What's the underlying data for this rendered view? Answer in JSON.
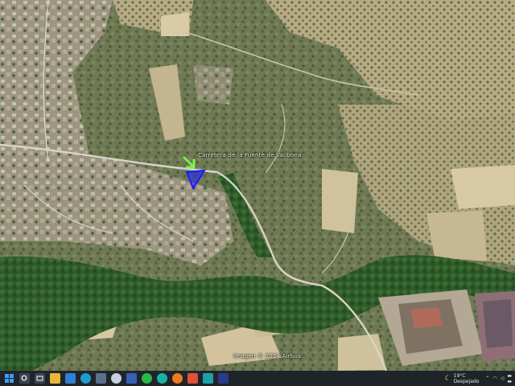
{
  "map": {
    "road_label": "Carretera de la Fuente de Vallbona",
    "copyright": "Imagen © 2024 Airbus",
    "marker_color": "#1a1aff",
    "pin_color": "#7cf04a"
  },
  "taskbar": {
    "apps": [
      {
        "name": "start-icon"
      },
      {
        "name": "search-icon"
      },
      {
        "name": "task-view-icon"
      },
      {
        "name": "file-explorer-icon"
      },
      {
        "name": "photos-icon"
      },
      {
        "name": "edge-icon"
      },
      {
        "name": "store-icon"
      },
      {
        "name": "media-icon"
      },
      {
        "name": "save-icon"
      },
      {
        "name": "whatsapp-icon"
      },
      {
        "name": "edge-dev-icon"
      },
      {
        "name": "firefox-icon"
      },
      {
        "name": "powerpoint-icon"
      },
      {
        "name": "sway-icon"
      },
      {
        "name": "paint-icon"
      }
    ],
    "weather": {
      "temp": "19°C",
      "condition": "Despejado"
    }
  }
}
